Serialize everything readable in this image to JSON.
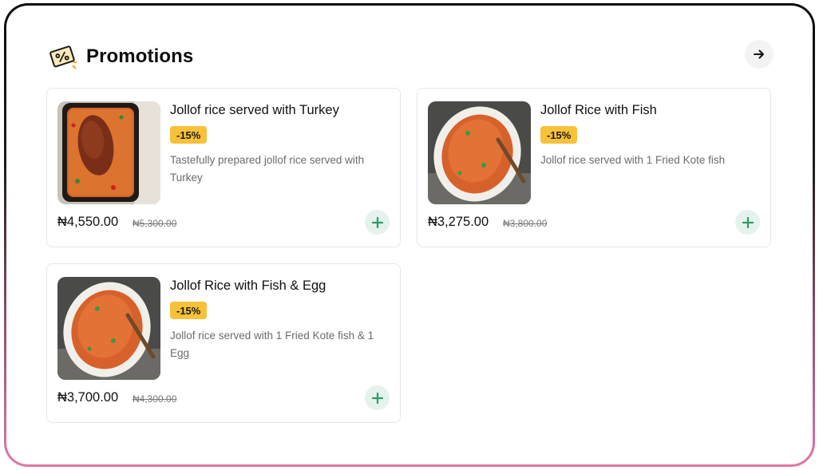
{
  "section": {
    "title": "Promotions",
    "icon": "discount-tag-icon",
    "next_icon": "arrow-right-icon"
  },
  "items": [
    {
      "name": "Jollof rice served with Turkey",
      "discount": "-15%",
      "description": "Tastefully prepared jollof rice served with Turkey",
      "price": "₦4,550.00",
      "old_price": "₦5,300.00",
      "image": "jollof-rice-turkey-photo"
    },
    {
      "name": "Jollof Rice with Fish",
      "discount": "-15%",
      "description": "Jollof rice served with 1 Fried Kote fish",
      "price": "₦3,275.00",
      "old_price": "₦3,800.00",
      "image": "jollof-rice-fish-photo"
    },
    {
      "name": "Jollof Rice with Fish & Egg",
      "discount": "-15%",
      "description": "Jollof rice served with 1 Fried Kote fish & 1 Egg",
      "price": "₦3,700.00",
      "old_price": "₦4,300.00",
      "image": "jollof-rice-fish-egg-photo"
    }
  ],
  "colors": {
    "badge": "#f7c13a",
    "add_button_bg": "#e5f3ec",
    "add_button_icon": "#2e9c6a",
    "border_top": "#0b0b0b",
    "border_bottom": "#e276a8"
  }
}
